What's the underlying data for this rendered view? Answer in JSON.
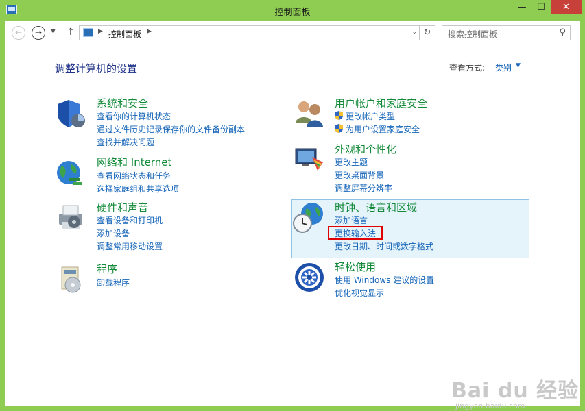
{
  "window": {
    "title": "控制面板",
    "minimize_glyph": "—",
    "maximize_glyph": "☐",
    "close_glyph": "✕"
  },
  "navbar": {
    "back_glyph": "←",
    "forward_glyph": "→",
    "recent_glyph": "▼",
    "up_glyph": "↑",
    "breadcrumb": "控制面板",
    "refresh_glyph": "↻",
    "dropdown_glyph": "⌄",
    "search_placeholder": "搜索控制面板",
    "search_glyph": "⚲"
  },
  "main": {
    "heading": "调整计算机的设置",
    "view_by_label": "查看方式:",
    "view_by_value": "类别",
    "view_by_caret": "▼"
  },
  "categories": [
    {
      "title": "系统和安全",
      "links": [
        "查看你的计算机状态",
        "通过文件历史记录保存你的文件备份副本",
        "查找并解决问题"
      ]
    },
    {
      "title": "网络和 Internet",
      "links": [
        "查看网络状态和任务",
        "选择家庭组和共享选项"
      ]
    },
    {
      "title": "硬件和声音",
      "links": [
        "查看设备和打印机",
        "添加设备",
        "调整常用移动设置"
      ]
    },
    {
      "title": "程序",
      "links": [
        "卸载程序"
      ]
    },
    {
      "title": "用户帐户和家庭安全",
      "links": [
        "更改帐户类型",
        "为用户设置家庭安全"
      ]
    },
    {
      "title": "外观和个性化",
      "links": [
        "更改主题",
        "更改桌面背景",
        "调整屏幕分辨率"
      ]
    },
    {
      "title": "时钟、语言和区域",
      "links": [
        "添加语言",
        "更换输入法",
        "更改日期、时间或数字格式"
      ]
    },
    {
      "title": "轻松使用",
      "links": [
        "使用 Windows 建议的设置",
        "优化视觉显示"
      ]
    }
  ],
  "watermark": {
    "text": "Bai du 经验",
    "sub": "jingyan.baidu.com"
  },
  "colors": {
    "frame": "#8fcd52",
    "category_title": "#128a38",
    "link": "#1565b8",
    "heading": "#1e3287",
    "highlight_bg": "#e5f3fb",
    "annotation_box": "#e00000"
  }
}
